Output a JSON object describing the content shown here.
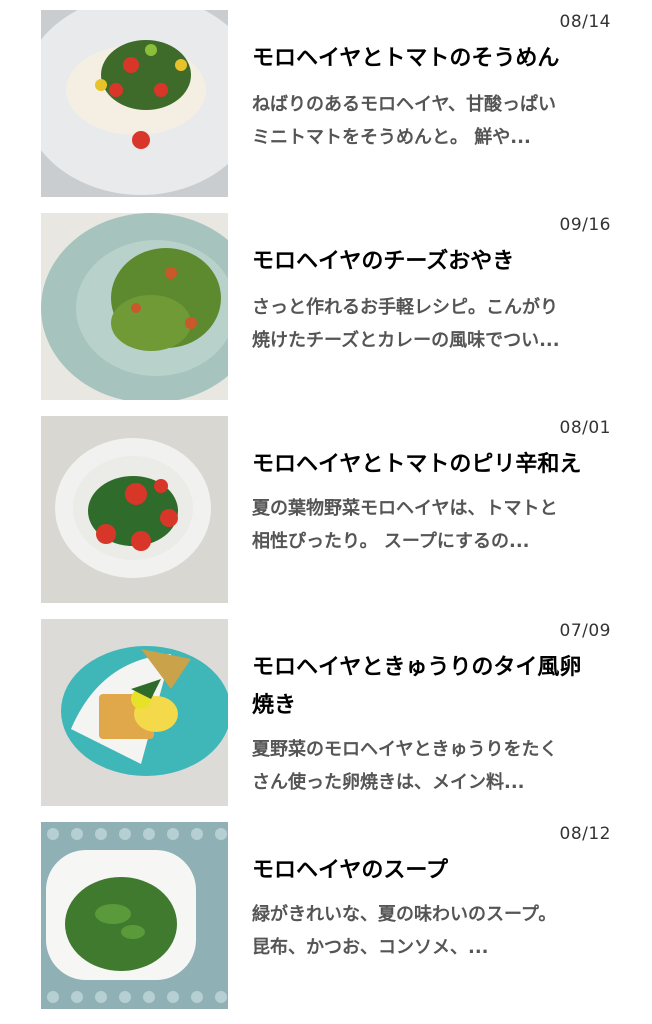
{
  "articles": [
    {
      "date": "08/14",
      "title": "モロヘイヤとトマトのそうめん",
      "desc_line1": "ねばりのあるモロヘイヤ、甘酸っぱい",
      "desc_line2": "ミニトマトをそうめんと。 鮮や..."
    },
    {
      "date": "09/16",
      "title": "モロヘイヤのチーズおやき",
      "desc_line1": "さっと作れるお手軽レシピ。こんがり",
      "desc_line2": "焼けたチーズとカレーの風味でつい..."
    },
    {
      "date": "08/01",
      "title": "モロヘイヤとトマトのピリ辛和え",
      "desc_line1": "夏の葉物野菜モロヘイヤは、トマトと",
      "desc_line2": "相性ぴったり。 スープにするの..."
    },
    {
      "date": "07/09",
      "title_line1": "モロヘイヤときゅうりのタイ風卵",
      "title_line2": "焼き",
      "desc_line1": "夏野菜のモロヘイヤときゅうりをたく",
      "desc_line2": "さん使った卵焼きは、メイン料..."
    },
    {
      "date": "08/12",
      "title": "モロヘイヤのスープ",
      "desc_line1": "緑がきれいな、夏の味わいのスープ。",
      "desc_line2": "昆布、かつお、コンソメ、..."
    }
  ]
}
